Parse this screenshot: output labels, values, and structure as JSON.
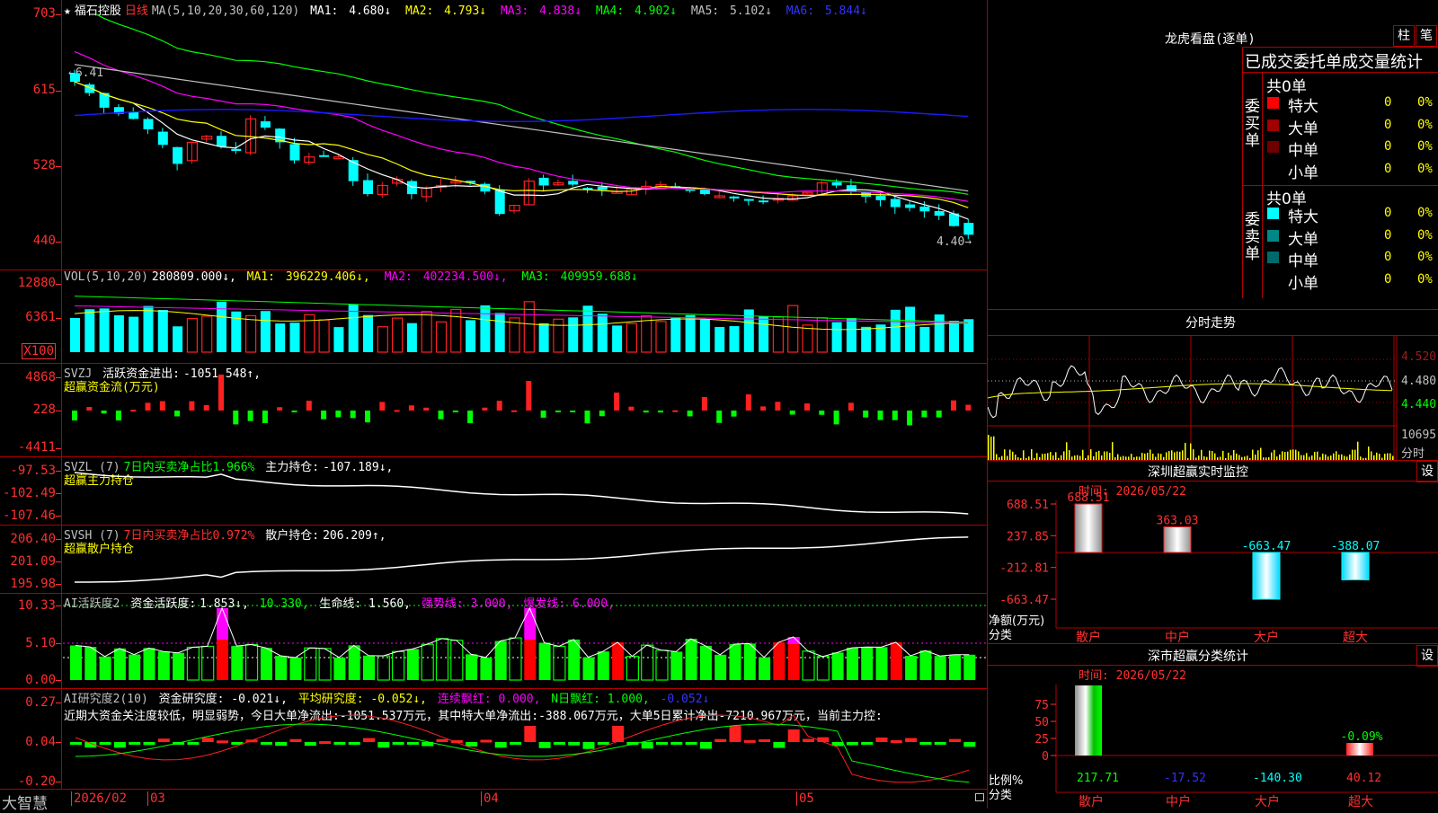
{
  "colors": {
    "up": "#ff2020",
    "down": "#00ffff",
    "bg": "#000000",
    "grid": "#b00000",
    "ma1": "#ffffff",
    "ma2": "#ffff00",
    "ma3": "#ff00ff",
    "ma4": "#00ff00",
    "ma5": "#c0c0c0",
    "ma6": "#1a1aff"
  },
  "price_panel": {
    "star": "★",
    "stock_name": "福石控股",
    "period": "日线",
    "ma_title": "MA(5,10,20,30,60,120)",
    "ma_values": [
      {
        "label": "MA1:",
        "value": "4.680↓"
      },
      {
        "label": "MA2:",
        "value": "4.793↓"
      },
      {
        "label": "MA3:",
        "value": "4.838↓"
      },
      {
        "label": "MA4:",
        "value": "4.902↓"
      },
      {
        "label": "MA5:",
        "value": "5.102↓"
      },
      {
        "label": "MA6:",
        "value": "5.844↓"
      }
    ],
    "y_labels": [
      "703",
      "615",
      "528",
      "440"
    ],
    "high_mark": "6.41",
    "low_mark": "4.40→"
  },
  "vol_panel": {
    "title": "VOL(5,10,20)",
    "value": "280809.000↓,",
    "ma": [
      {
        "label": "MA1:",
        "value": "396229.406↓,"
      },
      {
        "label": "MA2:",
        "value": "402234.500↓,"
      },
      {
        "label": "MA3:",
        "value": "409959.688↓"
      }
    ],
    "y_labels": [
      "12880",
      "6361"
    ],
    "unit": "X100"
  },
  "svzj_panel": {
    "title": "SVZJ",
    "item": "活跃资金进出:",
    "value": "-1051.548↑,",
    "sub": "超赢资金流(万元)",
    "y_labels": [
      "4868",
      "228",
      "-4411"
    ]
  },
  "svzl_panel": {
    "title": "SVZL (7)",
    "ratio": "7日内买卖净占比1.966%",
    "item": "主力持仓:",
    "value": "-107.189↓,",
    "sub": "超赢主力持仓",
    "y_labels": [
      "-97.53",
      "-102.49",
      "-107.46"
    ]
  },
  "svsh_panel": {
    "title": "SVSH (7)",
    "ratio": "7日内买卖净占比0.972%",
    "item": "散户持仓:",
    "value": "206.209↑,",
    "sub": "超赢散户持仓",
    "y_labels": [
      "206.40",
      "201.09",
      "195.98"
    ]
  },
  "ai_panel": {
    "title": "AI活跃度2",
    "item": "资金活跃度:",
    "value": "1.853↓,",
    "v2": "10.330,",
    "life": "生命线: 1.560,",
    "strong": "强势线: 3.000,",
    "burst": "爆发线: 6.000,",
    "y_labels": [
      "10.33",
      "5.10",
      "0.00"
    ]
  },
  "research_panel": {
    "title": "AI研究度2(10)",
    "item1": "资金研究度: -0.021↓,",
    "item2": "平均研究度: -0.052↓,",
    "item3": "连续飘红: 0.000,",
    "item4": "N日飘红: 1.000,",
    "item5": "-0.052↓",
    "comment": "近期大资金关注度较低，明显弱势，今日大单净流出:-1051.537万元，其中特大单净流出:-388.067万元，大单5日累计净出-7210.967万元，当前主力控:",
    "y_labels": [
      "0.27",
      "0.04",
      "-0.20"
    ]
  },
  "date_axis": {
    "app_name": "大智慧",
    "labels": [
      {
        "text": "2026/02"
      },
      {
        "text": "03"
      },
      {
        "text": "04"
      },
      {
        "text": "05"
      }
    ]
  },
  "dragon_tiger": {
    "title": "龙虎看盘(逐单)",
    "btn_bar": "柱",
    "btn_pen": "笔",
    "subtitle": "已成交委托单成交量统计",
    "buy_label": "委买单",
    "sell_label": "委卖单",
    "buy_total": "共0单",
    "sell_total": "共0单",
    "buy_rows": [
      {
        "name": "特大",
        "count": "0",
        "pct": "0%",
        "color": "#ff0000"
      },
      {
        "name": "大单",
        "count": "0",
        "pct": "0%",
        "color": "#a00000"
      },
      {
        "name": "中单",
        "count": "0",
        "pct": "0%",
        "color": "#700000"
      },
      {
        "name": "小单",
        "count": "0",
        "pct": "0%",
        "color": "#000000"
      }
    ],
    "sell_rows": [
      {
        "name": "特大",
        "count": "0",
        "pct": "0%",
        "color": "#00ffff"
      },
      {
        "name": "大单",
        "count": "0",
        "pct": "0%",
        "color": "#008888"
      },
      {
        "name": "中单",
        "count": "0",
        "pct": "0%",
        "color": "#006a6a"
      },
      {
        "name": "小单",
        "count": "0",
        "pct": "0%",
        "color": "#000000"
      }
    ]
  },
  "intraday": {
    "title": "分时走势",
    "y_labels": [
      "4.520",
      "4.480",
      "4.440"
    ],
    "vol_label": "10695",
    "vol_unit": "分时"
  },
  "sz_monitor": {
    "title": "深圳超赢实时监控",
    "btn": "设",
    "time": "时间: 2026/05/22",
    "y_labels": [
      "688.51",
      "237.85",
      "-212.81",
      "-663.47"
    ],
    "net_label": "净额(万元)",
    "cat_label": "分类",
    "chart_data": {
      "type": "bar",
      "categories": [
        "散户",
        "中户",
        "大户",
        "超大"
      ],
      "values": [
        688.51,
        363.03,
        -663.47,
        -388.07
      ],
      "value_labels": [
        "688.51",
        "363.03",
        "-663.47",
        "-388.07"
      ]
    }
  },
  "sz_class": {
    "title": "深市超赢分类统计",
    "btn": "设",
    "time": "时间: 2026/05/22",
    "y_labels": [
      "75",
      "50",
      "25",
      "0"
    ],
    "ratio_label": "比例%",
    "cat_label": "分类",
    "chart_data": {
      "type": "bar",
      "categories": [
        "散户",
        "中户",
        "大户",
        "超大"
      ],
      "values": [
        217.71,
        -17.52,
        -140.3,
        40.12
      ],
      "value_labels": [
        "217.71",
        "-17.52",
        "-140.30",
        "40.12"
      ],
      "pct_label": "-0.09%"
    }
  }
}
